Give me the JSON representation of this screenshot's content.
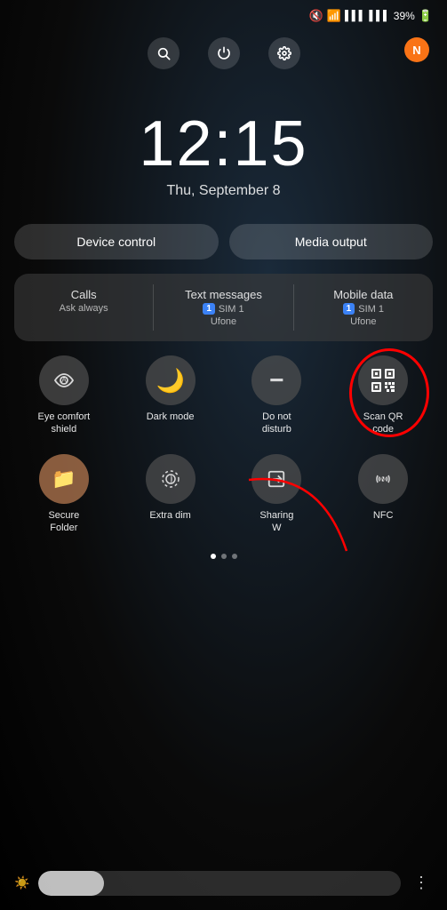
{
  "statusBar": {
    "battery": "39%",
    "icons": [
      "mute",
      "wifi",
      "signal",
      "signal2"
    ]
  },
  "topIcons": {
    "search_label": "search",
    "power_label": "power",
    "settings_label": "settings",
    "notification_label": "N"
  },
  "clock": {
    "time": "12:15",
    "date": "Thu, September 8"
  },
  "quickButtons": {
    "device_control": "Device control",
    "media_output": "Media output"
  },
  "simPanel": {
    "items": [
      {
        "label": "Calls",
        "sub": "Ask always",
        "sim_badge": "",
        "sim_name": ""
      },
      {
        "label": "Text messages",
        "sub": "",
        "sim_badge": "1",
        "sim_name": "SIM 1",
        "carrier": "Ufone"
      },
      {
        "label": "Mobile data",
        "sub": "",
        "sim_badge": "1",
        "sim_name": "SIM 1",
        "carrier": "Ufone"
      }
    ]
  },
  "toggles": {
    "row1": [
      {
        "icon": "Aa",
        "label": "Eye comfort\nshield",
        "active": false,
        "name": "eye-comfort"
      },
      {
        "icon": "🌙",
        "label": "Dark mode",
        "active": false,
        "name": "dark-mode"
      },
      {
        "icon": "−",
        "label": "Do not\ndisturb",
        "active": false,
        "name": "do-not-disturb"
      },
      {
        "icon": "qr",
        "label": "Scan QR\ncode",
        "active": false,
        "name": "scan-qr"
      }
    ],
    "row2": [
      {
        "icon": "📁",
        "label": "Secure\nFolder",
        "active": false,
        "name": "secure-folder"
      },
      {
        "icon": "⊕",
        "label": "Extra dim",
        "active": false,
        "name": "extra-dim"
      },
      {
        "icon": "↗",
        "label": "Sharing\nW",
        "active": false,
        "name": "sharing"
      },
      {
        "icon": "N",
        "label": "NFC",
        "active": false,
        "name": "nfc"
      }
    ]
  },
  "pageDots": {
    "count": 3,
    "active": 0
  },
  "bottomBar": {
    "brightness_pct": 18,
    "more_label": "⋮"
  }
}
